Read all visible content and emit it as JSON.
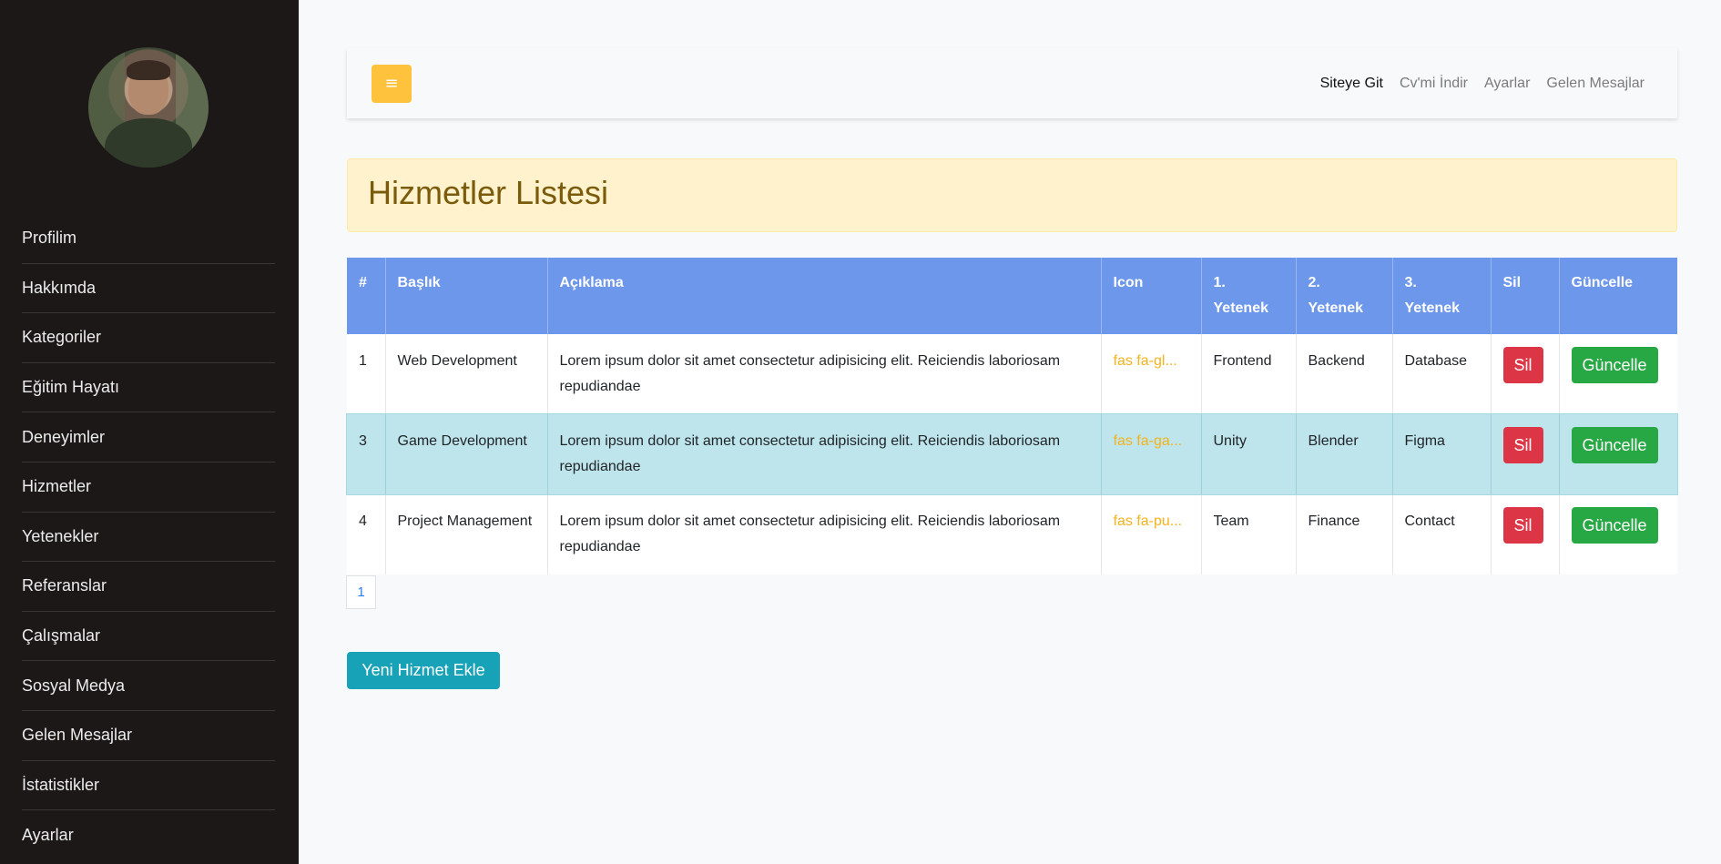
{
  "sidebar": {
    "avatar_alt": "profile photo",
    "items": [
      {
        "label": "Profilim"
      },
      {
        "label": "Hakkımda"
      },
      {
        "label": "Kategoriler"
      },
      {
        "label": "Eğitim Hayatı"
      },
      {
        "label": "Deneyimler"
      },
      {
        "label": "Hizmetler"
      },
      {
        "label": "Yetenekler"
      },
      {
        "label": "Referanslar"
      },
      {
        "label": "Çalışmalar"
      },
      {
        "label": "Sosyal Medya"
      },
      {
        "label": "Gelen Mesajlar"
      },
      {
        "label": "İstatistikler"
      },
      {
        "label": "Ayarlar"
      }
    ]
  },
  "navbar": {
    "toggle_icon": "hamburger-icon",
    "toggle_glyph": "≡",
    "links": [
      {
        "label": "Siteye Git",
        "active": true
      },
      {
        "label": "Cv'mi İndir"
      },
      {
        "label": "Ayarlar"
      },
      {
        "label": "Gelen Mesajlar"
      }
    ]
  },
  "page": {
    "title": "Hizmetler Listesi"
  },
  "table": {
    "headers": {
      "num": "#",
      "title": "Başlık",
      "desc": "Açıklama",
      "icon": "Icon",
      "skill1_a": "1.",
      "skill1_b": "Yetenek",
      "skill2_a": "2.",
      "skill2_b": "Yetenek",
      "skill3_a": "3.",
      "skill3_b": "Yetenek",
      "delete": "Sil",
      "update": "Güncelle"
    },
    "rows": [
      {
        "id": "1",
        "title": "Web Development",
        "desc": "Lorem ipsum dolor sit amet consectetur adipisicing elit. Reiciendis laboriosam repudiandae",
        "icon": "fas fa-gl...",
        "skill1": "Frontend",
        "skill2": "Backend",
        "skill3": "Database",
        "delete_label": "Sil",
        "update_label": "Güncelle"
      },
      {
        "id": "3",
        "title": "Game Development",
        "desc": "Lorem ipsum dolor sit amet consectetur adipisicing elit. Reiciendis laboriosam repudiandae",
        "icon": "fas fa-ga...",
        "skill1": "Unity",
        "skill2": "Blender",
        "skill3": "Figma",
        "delete_label": "Sil",
        "update_label": "Güncelle"
      },
      {
        "id": "4",
        "title": "Project Management",
        "desc": "Lorem ipsum dolor sit amet consectetur adipisicing elit. Reiciendis laboriosam repudiandae",
        "icon": "fas fa-pu...",
        "skill1": "Team",
        "skill2": "Finance",
        "skill3": "Contact",
        "delete_label": "Sil",
        "update_label": "Güncelle"
      }
    ]
  },
  "pagination": {
    "current": "1"
  },
  "actions": {
    "add_label": "Yeni Hizmet Ekle"
  },
  "colors": {
    "sidebar_bg": "#1c1818",
    "accent_yellow": "#ffc23c",
    "table_header": "#6d97ea",
    "highlight_row": "#bee5eb",
    "danger": "#dc3545",
    "success": "#28a745",
    "info": "#17a2b8"
  }
}
